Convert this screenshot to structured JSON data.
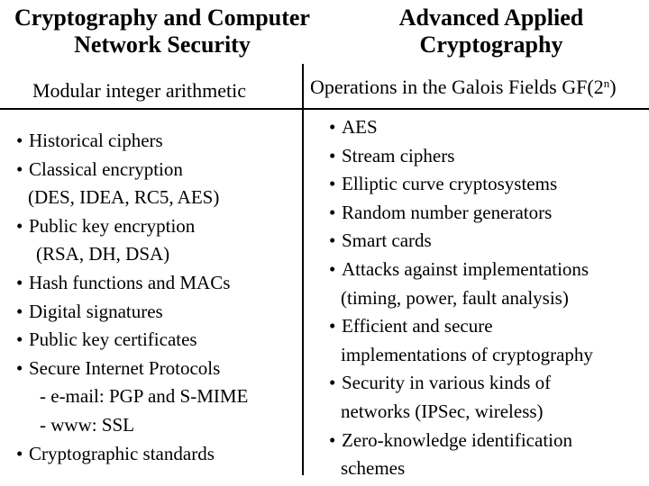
{
  "left_column": {
    "title": "Cryptography and Computer\nNetwork Security",
    "title_line1": "Cryptography and Computer",
    "title_line2": "Network Security",
    "subheading": "Modular integer arithmetic",
    "items": [
      {
        "bullet": "•",
        "text": "Historical ciphers",
        "kind": "bullet"
      },
      {
        "bullet": "•",
        "text": "Classical encryption",
        "kind": "bullet"
      },
      {
        "bullet": "",
        "text": "(DES, IDEA, RC5, AES)",
        "kind": "continuation"
      },
      {
        "bullet": "•",
        "text": "Public key encryption",
        "kind": "bullet"
      },
      {
        "bullet": "",
        "text": "(RSA, DH, DSA)",
        "kind": "continuation2"
      },
      {
        "bullet": "•",
        "text": "Hash functions and MACs",
        "kind": "bullet"
      },
      {
        "bullet": "•",
        "text": "Digital signatures",
        "kind": "bullet"
      },
      {
        "bullet": "•",
        "text": "Public key certificates",
        "kind": "bullet"
      },
      {
        "bullet": "•",
        "text": "Secure Internet Protocols",
        "kind": "bullet"
      },
      {
        "bullet": "",
        "text": "- e-mail: PGP and S-MIME",
        "kind": "sub"
      },
      {
        "bullet": "",
        "text": "- www: SSL",
        "kind": "sub"
      },
      {
        "bullet": "•",
        "text": "Cryptographic standards",
        "kind": "bullet"
      }
    ]
  },
  "right_column": {
    "title_line1": "Advanced Applied",
    "title_line2": "Cryptography",
    "subheading_text": "Operations in the Galois Fields GF(2",
    "subheading_sup": "n",
    "subheading_close": ")",
    "items": [
      {
        "bullet": "•",
        "text": "AES",
        "kind": "bullet"
      },
      {
        "bullet": "•",
        "text": "Stream ciphers",
        "kind": "bullet"
      },
      {
        "bullet": "•",
        "text": "Elliptic curve cryptosystems",
        "kind": "bullet"
      },
      {
        "bullet": "•",
        "text": "Random number generators",
        "kind": "bullet"
      },
      {
        "bullet": "•",
        "text": "Smart cards",
        "kind": "bullet"
      },
      {
        "bullet": "•",
        "text": "Attacks against implementations",
        "kind": "bullet"
      },
      {
        "bullet": "",
        "text": "(timing, power, fault analysis)",
        "kind": "continuation"
      },
      {
        "bullet": "•",
        "text": "Efficient and secure",
        "kind": "bullet"
      },
      {
        "bullet": "",
        "text": "implementations of cryptography",
        "kind": "continuation"
      },
      {
        "bullet": "•",
        "text": "Security in various kinds of",
        "kind": "bullet"
      },
      {
        "bullet": "",
        "text": "networks (IPSec, wireless)",
        "kind": "continuation"
      },
      {
        "bullet": "•",
        "text": "Zero-knowledge identification",
        "kind": "bullet"
      },
      {
        "bullet": "",
        "text": "schemes",
        "kind": "continuation"
      }
    ]
  }
}
